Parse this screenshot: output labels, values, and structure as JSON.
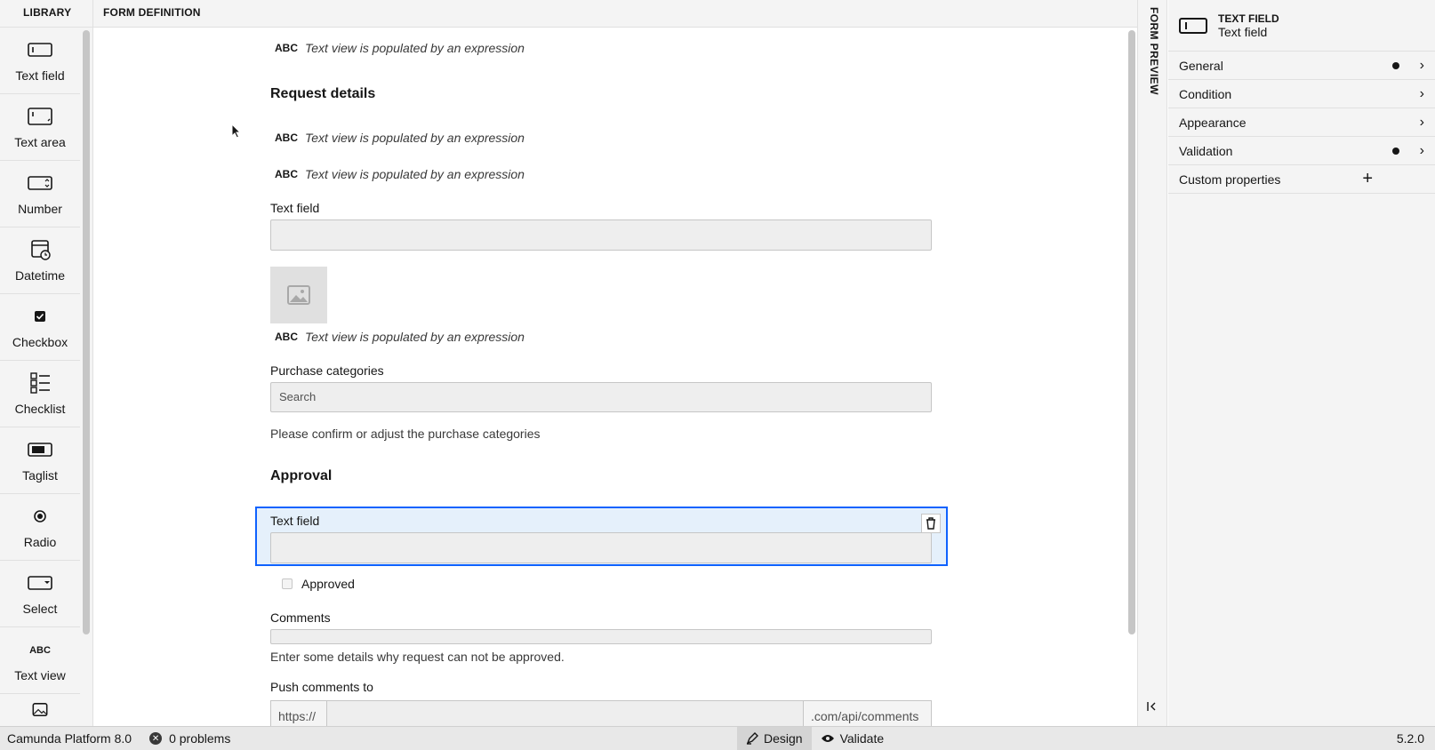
{
  "library": {
    "title": "LIBRARY",
    "items": [
      {
        "label": "Text field",
        "icon": "text-field-icon"
      },
      {
        "label": "Text area",
        "icon": "text-area-icon"
      },
      {
        "label": "Number",
        "icon": "number-icon"
      },
      {
        "label": "Datetime",
        "icon": "datetime-icon"
      },
      {
        "label": "Checkbox",
        "icon": "checkbox-icon"
      },
      {
        "label": "Checklist",
        "icon": "checklist-icon"
      },
      {
        "label": "Taglist",
        "icon": "taglist-icon"
      },
      {
        "label": "Radio",
        "icon": "radio-icon"
      },
      {
        "label": "Select",
        "icon": "select-icon"
      },
      {
        "label": "Text view",
        "icon": "text-view-icon",
        "icon_text": "ABC"
      },
      {
        "label": "",
        "icon": "image-icon"
      }
    ]
  },
  "form_definition": {
    "title": "FORM DEFINITION",
    "abc": "ABC",
    "text_view_placeholder": "Text view is populated by an expression",
    "heading_request": "Request details",
    "text_field_label": "Text field",
    "purchase_label": "Purchase categories",
    "purchase_placeholder": "Search",
    "purchase_description": "Please confirm or adjust the purchase categories",
    "heading_approval": "Approval",
    "selected_field_label": "Text field",
    "approved_label": "Approved",
    "comments_label": "Comments",
    "comments_description": "Enter some details why request can not be approved.",
    "push_label": "Push comments to",
    "push_prefix": "https://",
    "push_suffix": ".com/api/comments"
  },
  "preview": {
    "title": "FORM PREVIEW"
  },
  "properties": {
    "kind": "TEXT FIELD",
    "name": "Text field",
    "groups": [
      {
        "label": "General",
        "has_dot": true
      },
      {
        "label": "Condition",
        "has_dot": false
      },
      {
        "label": "Appearance",
        "has_dot": false
      },
      {
        "label": "Validation",
        "has_dot": true
      },
      {
        "label": "Custom properties",
        "has_dot": false
      }
    ]
  },
  "status": {
    "platform": "Camunda Platform 8.0",
    "problems": "0 problems",
    "design": "Design",
    "validate": "Validate",
    "version": "5.2.0"
  }
}
